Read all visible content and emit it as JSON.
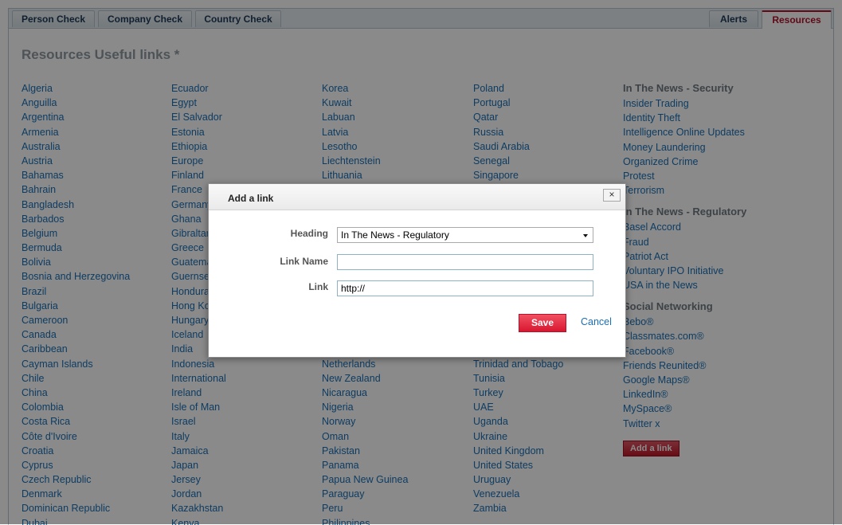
{
  "tabs_left": [
    "Person Check",
    "Company Check",
    "Country Check"
  ],
  "tabs_right": [
    "Alerts",
    "Resources"
  ],
  "page_title": "Resources Useful links *",
  "columns": [
    [
      "Algeria",
      "Anguilla",
      "Argentina",
      "Armenia",
      "Australia",
      "Austria",
      "Bahamas",
      "Bahrain",
      "Bangladesh",
      "Barbados",
      "Belgium",
      "Bermuda",
      "Bolivia",
      "Bosnia and Herzegovina",
      "Brazil",
      "Bulgaria",
      "Cameroon",
      "Canada",
      "Caribbean",
      "Cayman Islands",
      "Chile",
      "China",
      "Colombia",
      "Costa Rica",
      "Côte d'Ivoire",
      "Croatia",
      "Cyprus",
      "Czech Republic",
      "Denmark",
      "Dominican Republic",
      "Dubai"
    ],
    [
      "Ecuador",
      "Egypt",
      "El Salvador",
      "Estonia",
      "Ethiopia",
      "Europe",
      "Finland",
      "France",
      "Germany",
      "Ghana",
      "Gibraltar",
      "Greece",
      "Guatemala",
      "Guernsey",
      "Honduras",
      "Hong Kong",
      "Hungary",
      "Iceland",
      "India",
      "Indonesia",
      "International",
      "Ireland",
      "Isle of Man",
      "Israel",
      "Italy",
      "Jamaica",
      "Japan",
      "Jersey",
      "Jordan",
      "Kazakhstan",
      "Kenya"
    ],
    [
      "Korea",
      "Kuwait",
      "Labuan",
      "Latvia",
      "Lesotho",
      "Liechtenstein",
      "Lithuania",
      "",
      "",
      "",
      "",
      "",
      "",
      "",
      "",
      "",
      "",
      "",
      "",
      "Netherlands",
      "New Zealand",
      "Nicaragua",
      "Nigeria",
      "Norway",
      "Oman",
      "Pakistan",
      "Panama",
      "Papua New Guinea",
      "Paraguay",
      "Peru",
      "Philippines"
    ],
    [
      "Poland",
      "Portugal",
      "Qatar",
      "Russia",
      "Saudi Arabia",
      "Senegal",
      "Singapore",
      "",
      "",
      "",
      "",
      "",
      "",
      "",
      "",
      "",
      "",
      "",
      "",
      "Trinidad and Tobago",
      "Tunisia",
      "Turkey",
      "UAE",
      "Uganda",
      "Ukraine",
      "United Kingdom",
      "United States",
      "Uruguay",
      "Venezuela",
      "Zambia"
    ]
  ],
  "sections": [
    {
      "heading": "In The News - Security",
      "links": [
        "Insider Trading",
        "Identity Theft",
        "Intelligence Online Updates",
        "Money Laundering",
        "Organized Crime",
        "Protest",
        "Terrorism"
      ]
    },
    {
      "heading": "In The News - Regulatory",
      "links": [
        "Basel Accord",
        "Fraud",
        "Patriot Act",
        "Voluntary IPO Initiative",
        "USA in the News"
      ]
    },
    {
      "heading": "Social Networking",
      "links": [
        "Bebo®",
        "Classmates.com®",
        "Facebook®",
        "Friends Reunited®",
        "Google Maps®",
        "LinkedIn®",
        "MySpace®",
        "Twitter x"
      ]
    }
  ],
  "add_link_button": "Add a link",
  "modal": {
    "title": "Add a link",
    "close": "×",
    "heading_label": "Heading",
    "heading_value": "In The News - Regulatory",
    "link_name_label": "Link Name",
    "link_name_value": "",
    "link_label": "Link",
    "link_value": "http://",
    "save": "Save",
    "cancel": "Cancel"
  }
}
